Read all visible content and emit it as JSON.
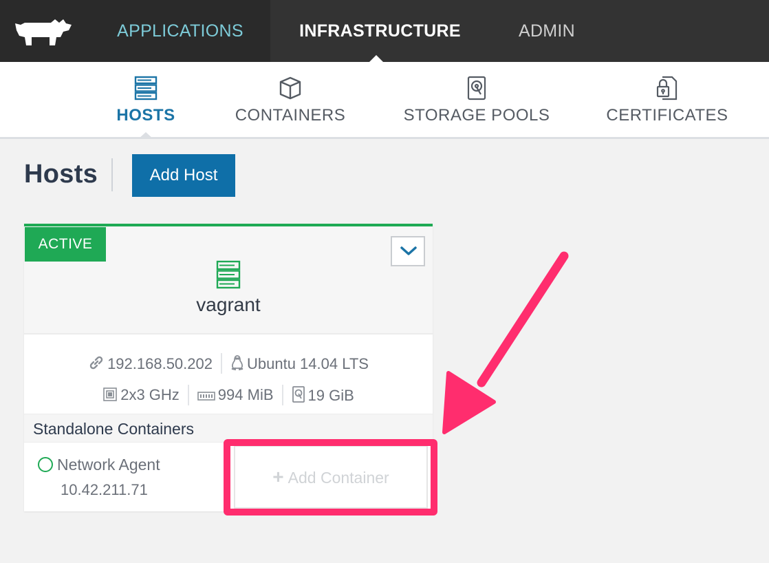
{
  "topnav": {
    "items": [
      {
        "label": "APPLICATIONS"
      },
      {
        "label": "INFRASTRUCTURE"
      },
      {
        "label": "ADMIN"
      }
    ],
    "active": "INFRASTRUCTURE",
    "logo_icon": "rancher-cow-icon"
  },
  "subnav": {
    "items": [
      {
        "label": "HOSTS",
        "icon": "server-icon"
      },
      {
        "label": "CONTAINERS",
        "icon": "cube-icon"
      },
      {
        "label": "STORAGE POOLS",
        "icon": "hard-drive-icon"
      },
      {
        "label": "CERTIFICATES",
        "icon": "lock-document-icon"
      }
    ],
    "active": "HOSTS"
  },
  "header": {
    "title": "Hosts",
    "add_button": "Add Host"
  },
  "host": {
    "state": "ACTIVE",
    "name": "vagrant",
    "ip": "192.168.50.202",
    "os": "Ubuntu 14.04 LTS",
    "cpu": "2x3 GHz",
    "memory": "994 MiB",
    "storage": "19 GiB",
    "section_label": "Standalone Containers",
    "containers": [
      {
        "name": "Network Agent",
        "ip": "10.42.211.71",
        "status": "running"
      }
    ],
    "add_container": "Add Container"
  },
  "colors": {
    "accent": "#0f6fa8",
    "active_green": "#1fa955",
    "annotation": "#ff2d6e",
    "nav_dark": "#2a2a2a"
  }
}
